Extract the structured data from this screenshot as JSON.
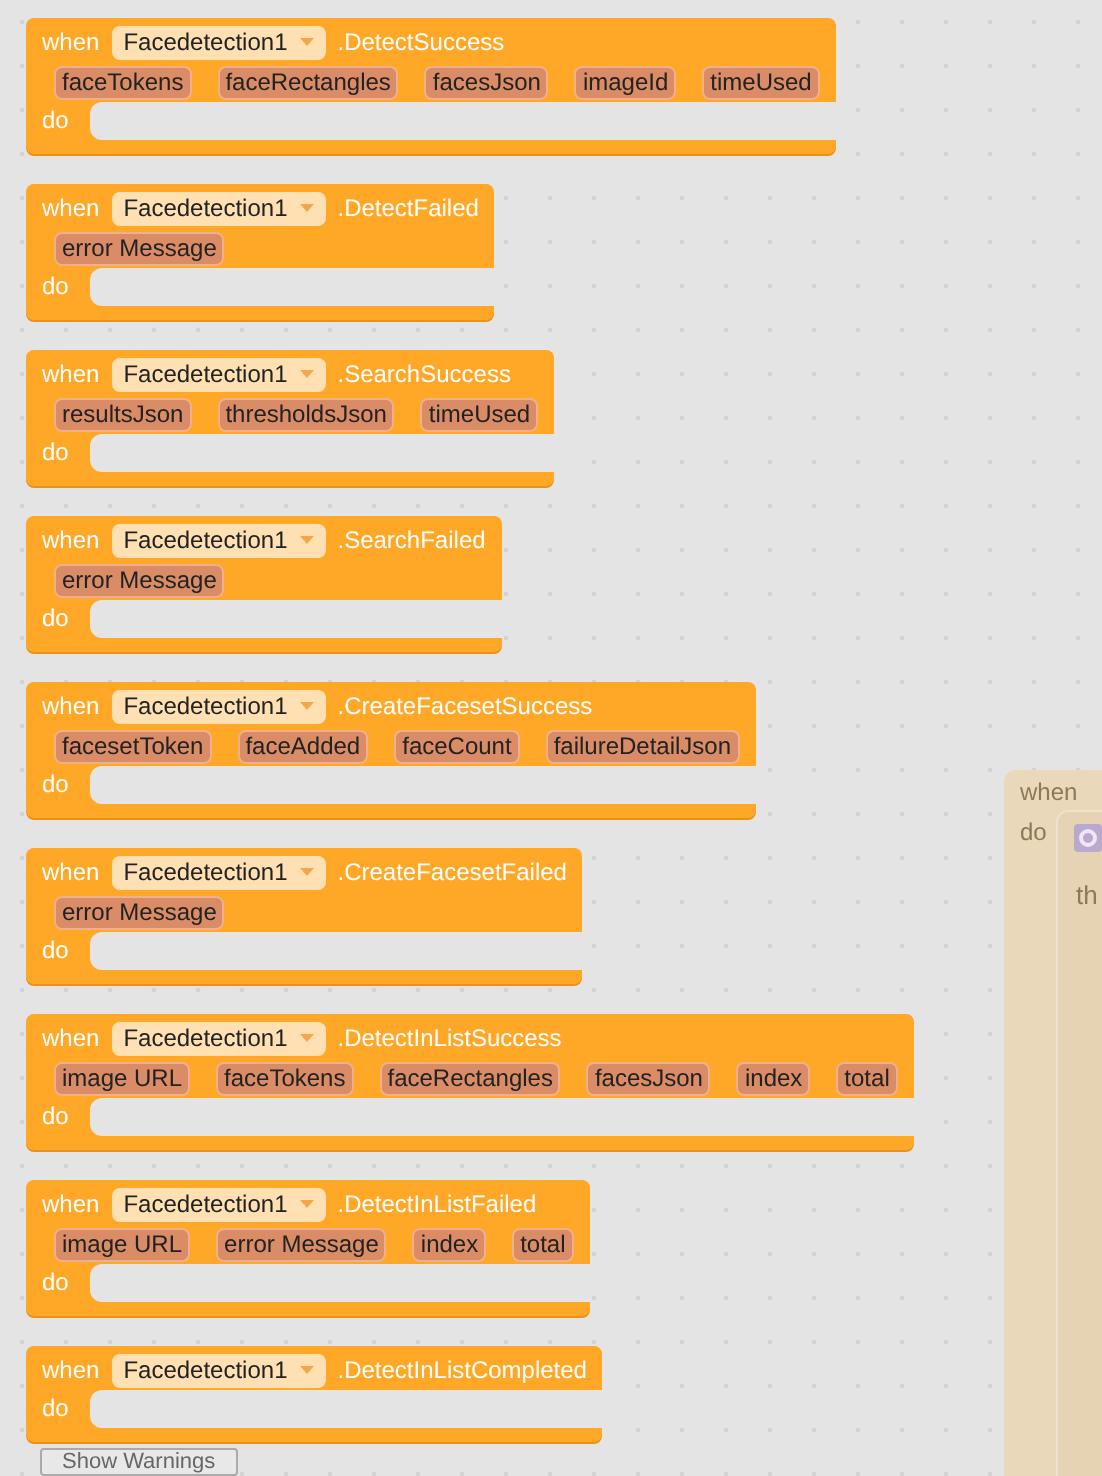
{
  "blocks": [
    {
      "keyword": "when",
      "component": "Facedetection1",
      "event": ".DetectSuccess",
      "params": [
        "faceTokens",
        "faceRectangles",
        "facesJson",
        "imageId",
        "timeUsed"
      ],
      "do_label": "do"
    },
    {
      "keyword": "when",
      "component": "Facedetection1",
      "event": ".DetectFailed",
      "params": [
        "error Message"
      ],
      "do_label": "do"
    },
    {
      "keyword": "when",
      "component": "Facedetection1",
      "event": ".SearchSuccess",
      "params": [
        "resultsJson",
        "thresholdsJson",
        "timeUsed"
      ],
      "do_label": "do"
    },
    {
      "keyword": "when",
      "component": "Facedetection1",
      "event": ".SearchFailed",
      "params": [
        "error Message"
      ],
      "do_label": "do"
    },
    {
      "keyword": "when",
      "component": "Facedetection1",
      "event": ".CreateFacesetSuccess",
      "params": [
        "facesetToken",
        "faceAdded",
        "faceCount",
        "failureDetailJson"
      ],
      "do_label": "do"
    },
    {
      "keyword": "when",
      "component": "Facedetection1",
      "event": ".CreateFacesetFailed",
      "params": [
        "error Message"
      ],
      "do_label": "do"
    },
    {
      "keyword": "when",
      "component": "Facedetection1",
      "event": ".DetectInListSuccess",
      "params": [
        "image URL",
        "faceTokens",
        "faceRectangles",
        "facesJson",
        "index",
        "total"
      ],
      "do_label": "do"
    },
    {
      "keyword": "when",
      "component": "Facedetection1",
      "event": ".DetectInListFailed",
      "params": [
        "image URL",
        "error Message",
        "index",
        "total"
      ],
      "do_label": "do"
    },
    {
      "keyword": "when",
      "component": "Facedetection1",
      "event": ".DetectInListCompleted",
      "do_label": "do"
    }
  ],
  "faded_block": {
    "keyword": "when",
    "do_label": "do",
    "inner_text": "th"
  },
  "show_warnings": "Show Warnings"
}
